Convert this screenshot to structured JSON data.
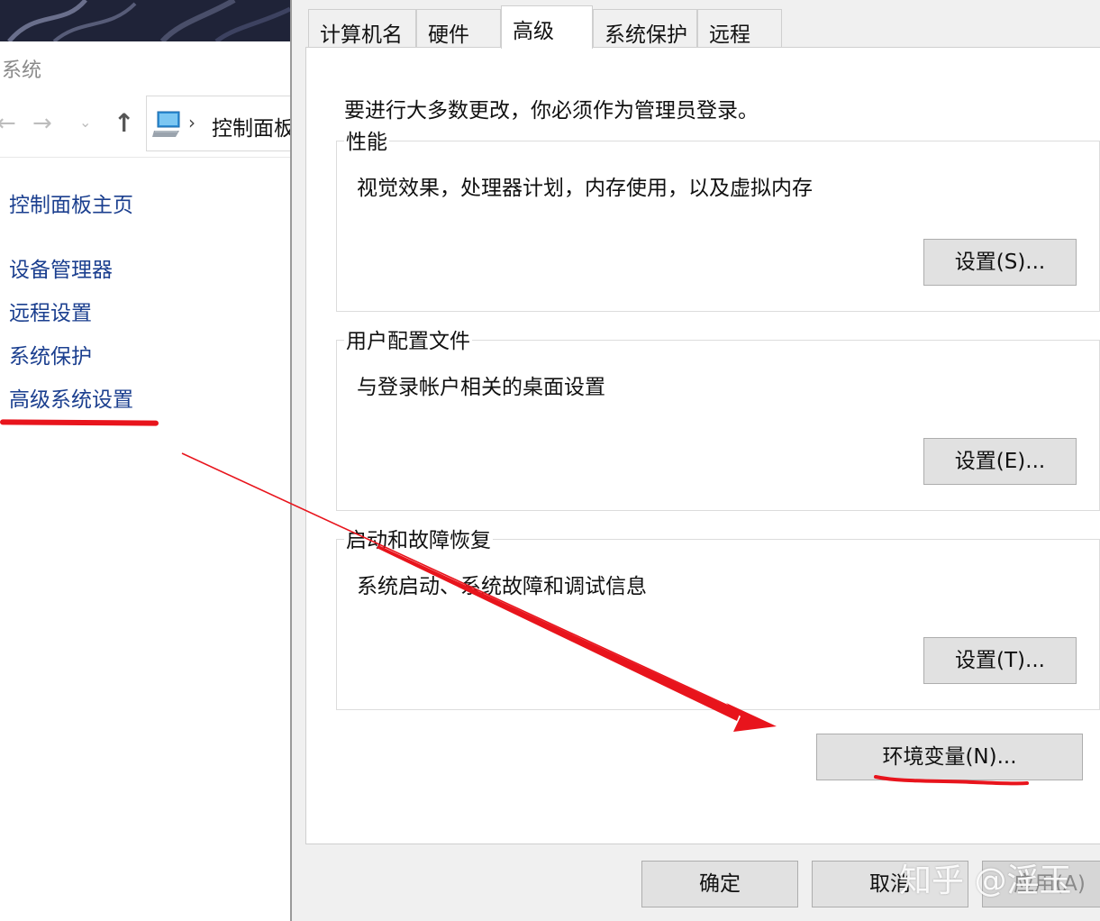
{
  "control_panel": {
    "title": "系统",
    "nav_icons": [
      "back-arrow-icon",
      "forward-arrow-icon",
      "recent-chevron-icon",
      "up-arrow-icon",
      "computer-icon",
      "breadcrumb-chevron-icon"
    ],
    "address_text": "控制面板",
    "links": [
      {
        "label": "控制面板主页"
      },
      {
        "label": "设备管理器"
      },
      {
        "label": "远程设置"
      },
      {
        "label": "系统保护"
      },
      {
        "label": "高级系统设置"
      }
    ]
  },
  "dialog": {
    "tabs": [
      {
        "label": "计算机名",
        "active": false
      },
      {
        "label": "硬件",
        "active": false
      },
      {
        "label": "高级",
        "active": true
      },
      {
        "label": "系统保护",
        "active": false
      },
      {
        "label": "远程",
        "active": false
      }
    ],
    "admin_message": "要进行大多数更改，你必须作为管理员登录。",
    "groups": [
      {
        "title": "性能",
        "description": "视觉效果，处理器计划，内存使用，以及虚拟内存",
        "button": "设置(S)..."
      },
      {
        "title": "用户配置文件",
        "description": "与登录帐户相关的桌面设置",
        "button": "设置(E)..."
      },
      {
        "title": "启动和故障恢复",
        "description": "系统启动、系统故障和调试信息",
        "button": "设置(T)..."
      }
    ],
    "env_button": "环境变量(N)...",
    "footer": {
      "ok": "确定",
      "cancel": "取消",
      "apply": "应用(A)"
    }
  },
  "watermark": "知乎 @淫玉",
  "annotation_color": "#e8141c"
}
